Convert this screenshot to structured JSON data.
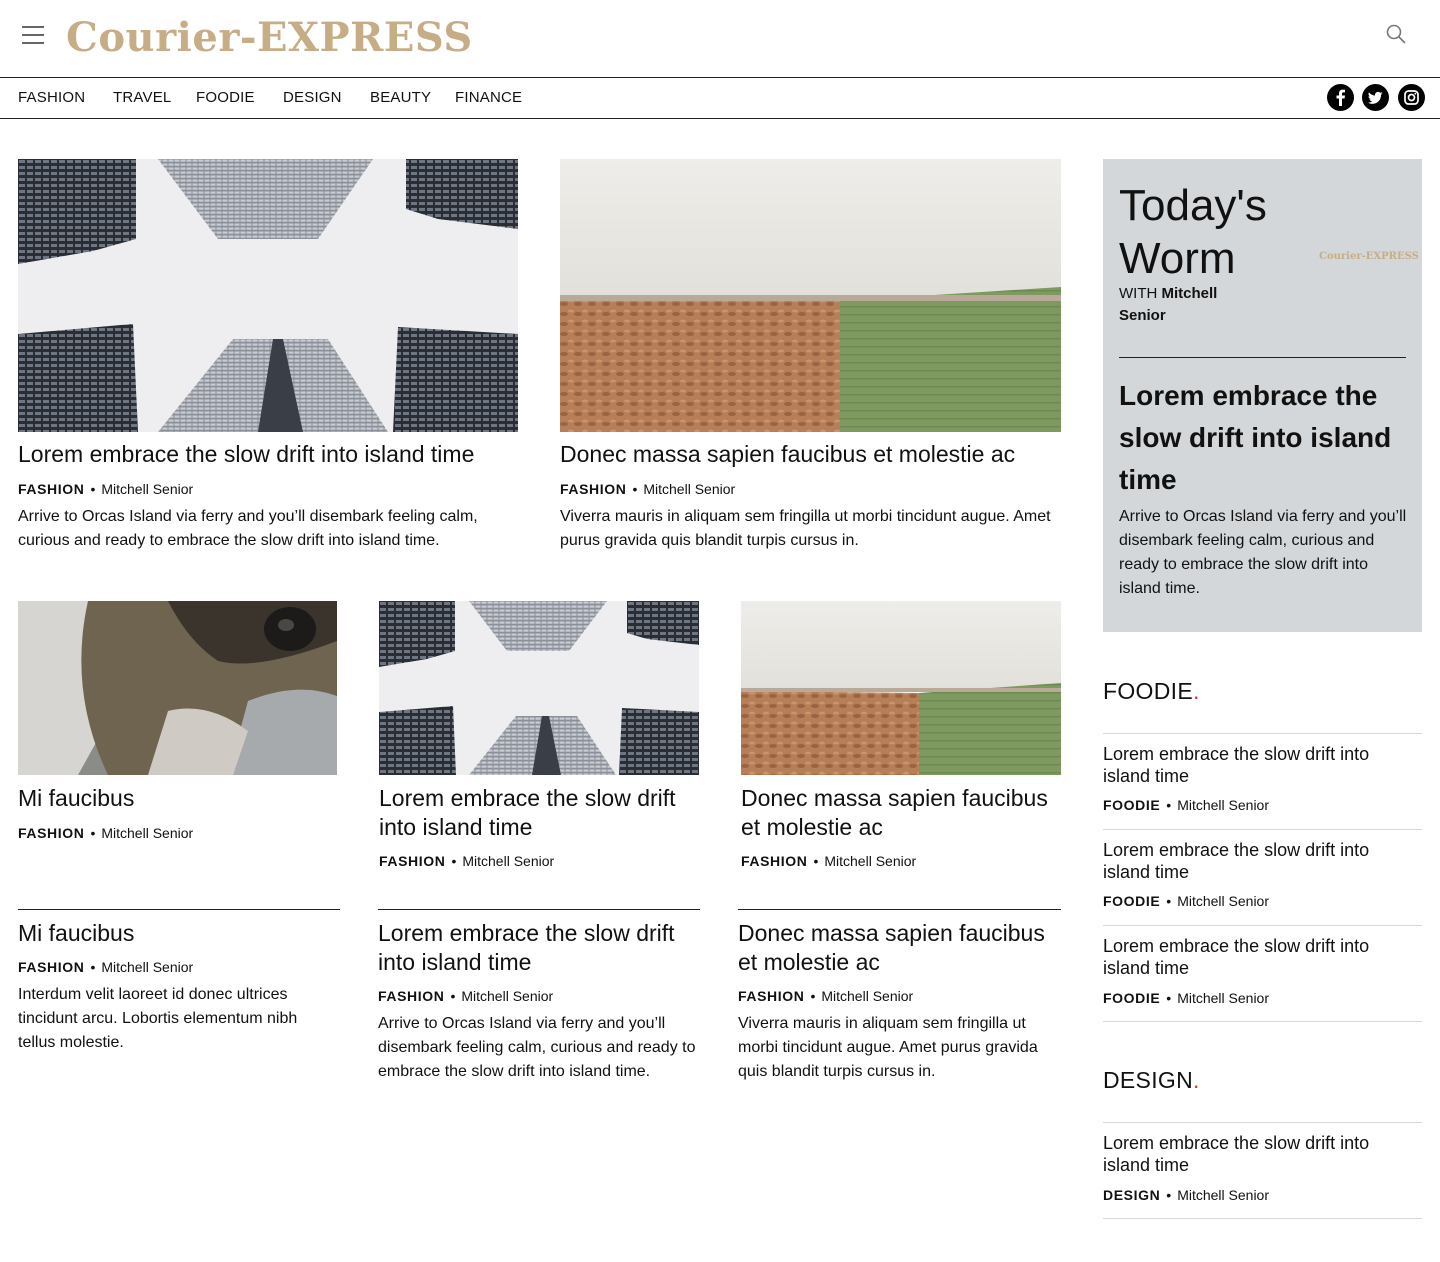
{
  "header": {
    "logo_text": "Courier-EXPRESS",
    "menu_icon": "hamburger-menu-icon",
    "search_icon": "search-icon"
  },
  "nav": {
    "items": [
      "FASHION",
      "TRAVEL",
      "FOODIE",
      "DESIGN",
      "BEAUTY",
      "FINANCE"
    ],
    "social": [
      "facebook-icon",
      "twitter-icon",
      "instagram-icon"
    ]
  },
  "featured": [
    {
      "image": "city-skyscrapers-photo",
      "title": "Lorem embrace the slow drift into island time",
      "category": "FASHION",
      "author": "Mitchell Senior",
      "excerpt": "Arrive to Orcas Island via ferry and you’ll disembark feeling calm, curious and ready to embrace the slow drift into island time."
    },
    {
      "image": "field-landscape-photo",
      "title": "Donec massa sapien faucibus et molestie ac",
      "category": "FASHION",
      "author": "Mitchell Senior",
      "excerpt": "Viverra mauris in aliquam sem fringilla ut morbi tincidunt augue. Amet purus gravida quis blandit turpis cursus in."
    }
  ],
  "grid": [
    {
      "image": "pug-dog-photo",
      "title": "Mi faucibus",
      "category": "FASHION",
      "author": "Mitchell Senior"
    },
    {
      "image": "city-skyscrapers-photo",
      "title": "Lorem embrace the slow drift into island time",
      "category": "FASHION",
      "author": "Mitchell Senior"
    },
    {
      "image": "field-landscape-photo",
      "title": "Donec massa sapien faucibus et molestie ac",
      "category": "FASHION",
      "author": "Mitchell Senior"
    }
  ],
  "text_articles": [
    {
      "title": "Mi faucibus",
      "category": "FASHION",
      "author": "Mitchell Senior",
      "excerpt": "Interdum velit laoreet id donec ultrices tincidunt arcu. Lobortis elementum nibh tellus molestie."
    },
    {
      "title": "Lorem embrace the slow drift into island time",
      "category": "FASHION",
      "author": "Mitchell Senior",
      "excerpt": "Arrive to Orcas Island via ferry and you’ll disembark feeling calm, curious and ready to embrace the slow drift into island time."
    },
    {
      "title": "Donec massa sapien faucibus et molestie ac",
      "category": "FASHION",
      "author": "Mitchell Senior",
      "excerpt": "Viverra mauris in aliquam sem fringilla ut morbi tincidunt augue. Amet purus gravida quis blandit turpis cursus in."
    }
  ],
  "promo": {
    "heading": "Today's Worm",
    "with_label": "WITH",
    "with_name": "Mitchell Senior",
    "logo_text": "Courier-EXPRESS",
    "title": "Lorem embrace the slow drift into island time",
    "excerpt": "Arrive to Orcas Island via ferry and you’ll disembark feeling calm, curious and ready to embrace the slow drift into island time."
  },
  "sections": [
    {
      "name": "FOODIE",
      "dot": ".",
      "items": [
        {
          "title": "Lorem embrace the slow drift into island time",
          "category": "FOODIE",
          "author": "Mitchell Senior"
        },
        {
          "title": "Lorem embrace the slow drift into island time",
          "category": "FOODIE",
          "author": "Mitchell Senior"
        },
        {
          "title": "Lorem embrace the slow drift into island time",
          "category": "FOODIE",
          "author": "Mitchell Senior"
        }
      ]
    },
    {
      "name": "DESIGN",
      "dot": ".",
      "items": [
        {
          "title": "Lorem embrace the slow drift into island time",
          "category": "DESIGN",
          "author": "Mitchell Senior"
        }
      ]
    }
  ],
  "colors": {
    "logo": "#c7ad86",
    "promo_bg": "#d4d7da",
    "accent": "#d9342b"
  }
}
